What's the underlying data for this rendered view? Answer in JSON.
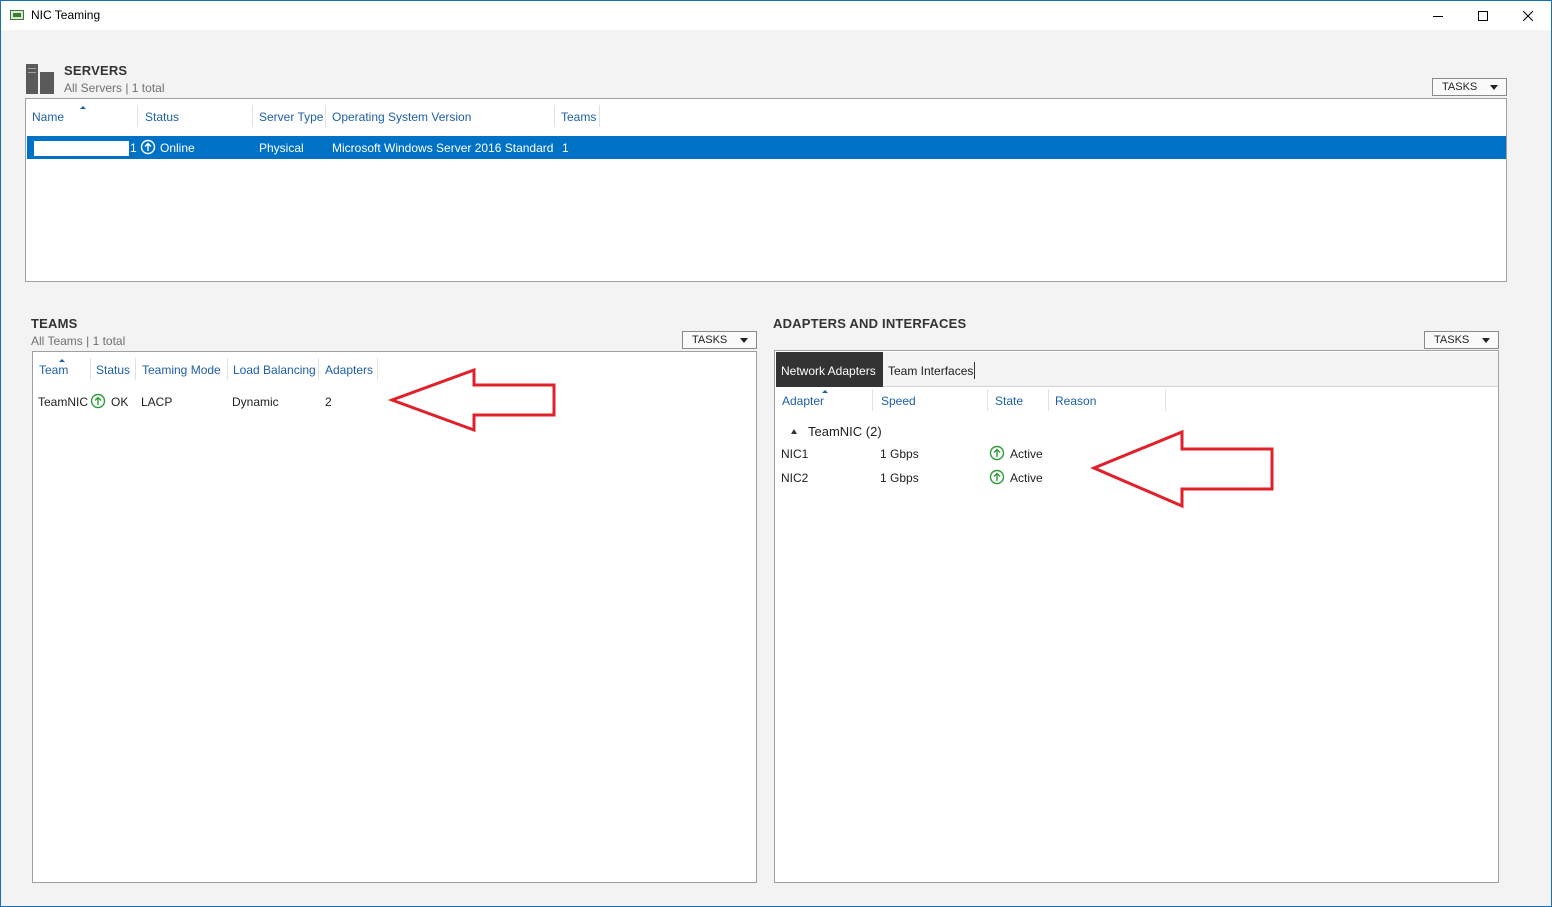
{
  "window": {
    "title": "NIC Teaming",
    "controls": [
      "minimize-icon",
      "maximize-icon",
      "close-icon"
    ]
  },
  "servers": {
    "title": "SERVERS",
    "subtitle": "All Servers | 1 total",
    "tasks_label": "TASKS",
    "columns": [
      "Name",
      "Status",
      "Server Type",
      "Operating System Version",
      "Teams"
    ],
    "rows": [
      {
        "name_suffix": "1",
        "status": "Online",
        "server_type": "Physical",
        "os_version": "Microsoft Windows Server 2016 Standard",
        "teams": "1"
      }
    ]
  },
  "teams": {
    "title": "TEAMS",
    "subtitle": "All Teams | 1 total",
    "tasks_label": "TASKS",
    "columns": [
      "Team",
      "Status",
      "Teaming Mode",
      "Load Balancing",
      "Adapters"
    ],
    "rows": [
      {
        "team": "TeamNIC",
        "status": "OK",
        "teaming_mode": "LACP",
        "load_balancing": "Dynamic",
        "adapters": "2"
      }
    ]
  },
  "adapters": {
    "title": "ADAPTERS AND INTERFACES",
    "tasks_label": "TASKS",
    "tabs": [
      {
        "label": "Network Adapters",
        "active": true
      },
      {
        "label": "Team Interfaces",
        "active": false
      }
    ],
    "columns": [
      "Adapter",
      "Speed",
      "State",
      "Reason"
    ],
    "group": "TeamNIC (2)",
    "rows": [
      {
        "adapter": "NIC1",
        "speed": "1 Gbps",
        "state": "Active",
        "reason": ""
      },
      {
        "adapter": "NIC2",
        "speed": "1 Gbps",
        "state": "Active",
        "reason": ""
      }
    ]
  },
  "colors": {
    "accent": "#0072c6",
    "header_text": "#1e5fa8",
    "status_ok": "#2e9b3a",
    "annotation_arrow": "#e0202a",
    "tab_active_bg": "#333333"
  }
}
